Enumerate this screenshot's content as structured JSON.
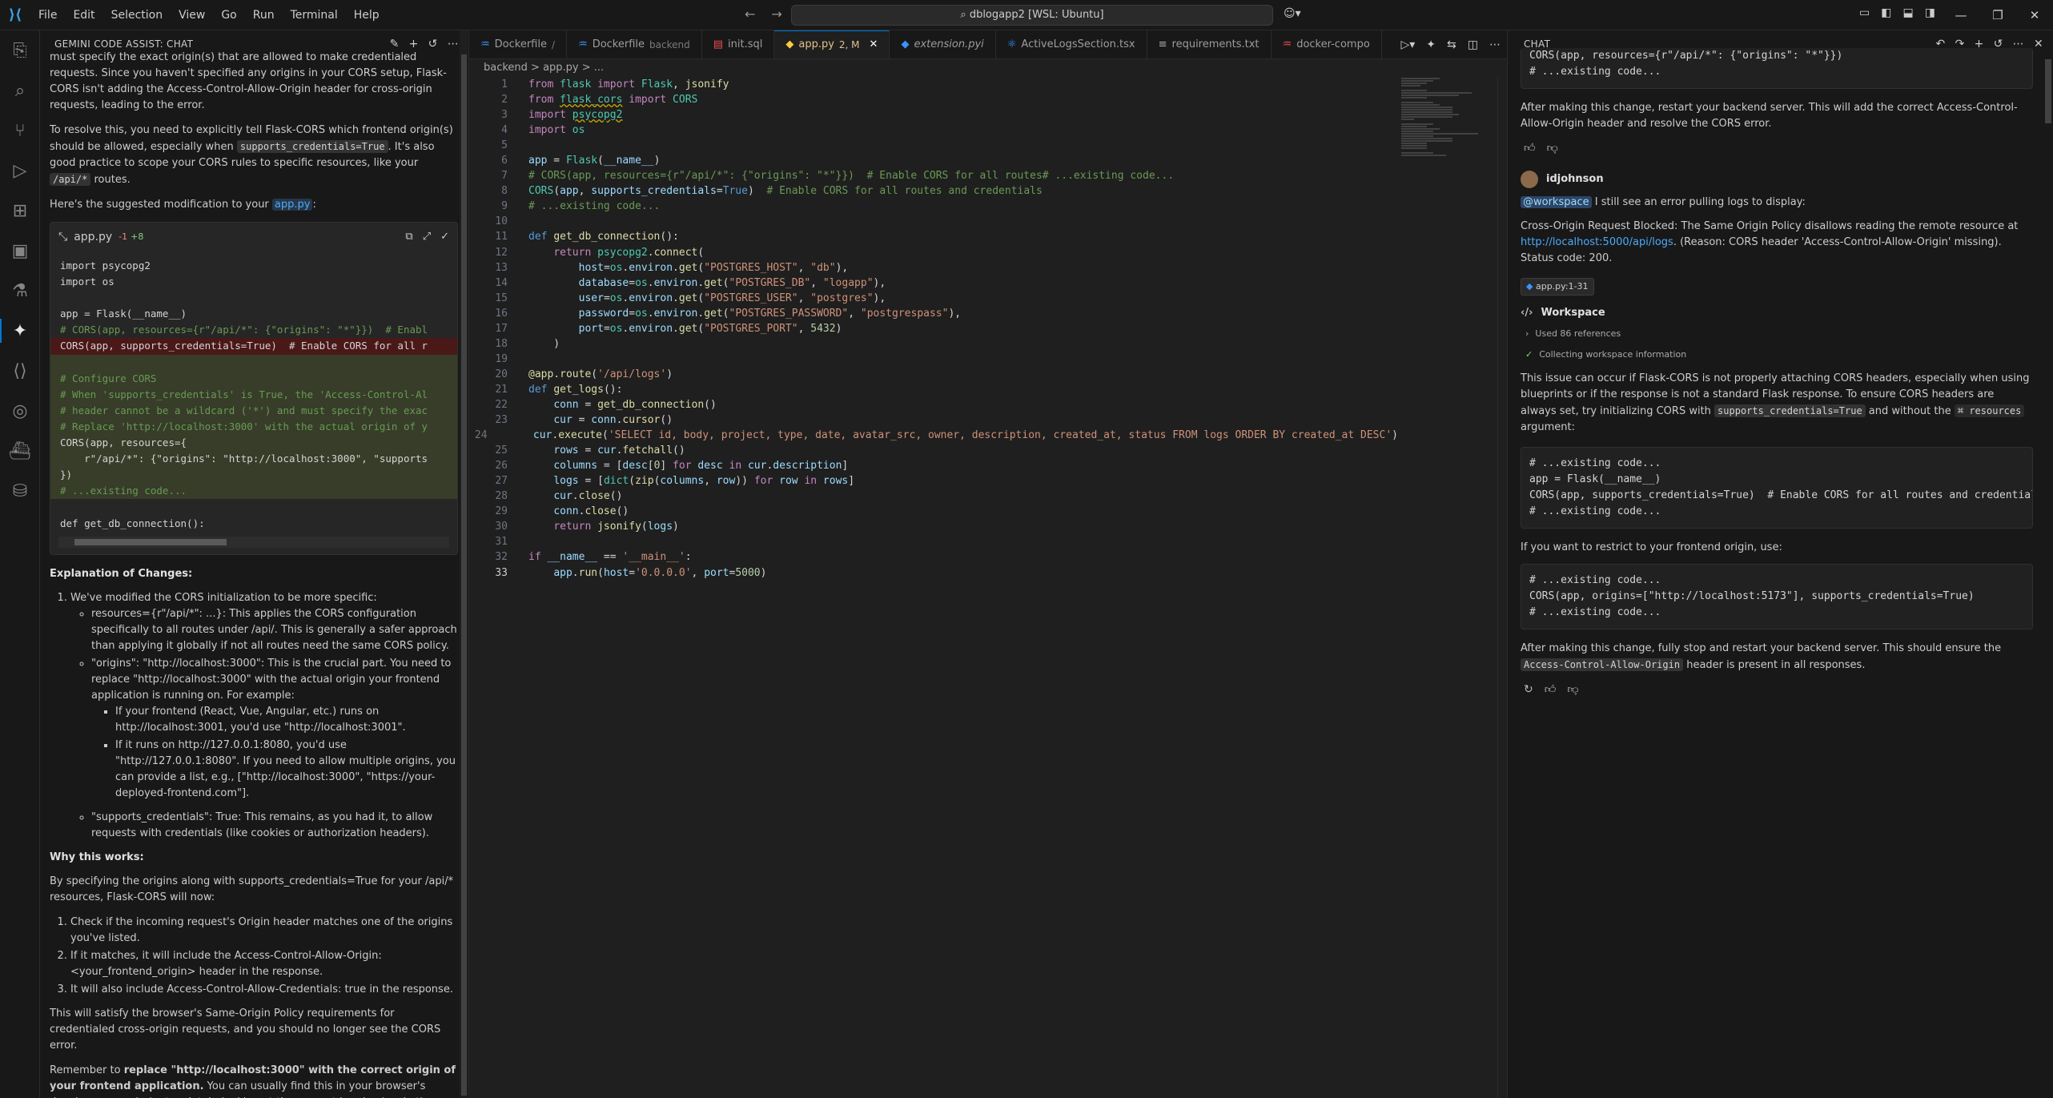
{
  "titlebar": {
    "menu": [
      "File",
      "Edit",
      "Selection",
      "View",
      "Go",
      "Run",
      "Terminal",
      "Help"
    ],
    "search": "dblogapp2 [WSL: Ubuntu]"
  },
  "left_panel": {
    "title": "GEMINI CODE ASSIST: CHAT",
    "p0": "must specify the exact origin(s) that are allowed to make credentialed requests. Since you haven't specified any origins in your CORS setup, Flask-CORS isn't adding the Access-Control-Allow-Origin header for cross-origin requests, leading to the error.",
    "p1a": "To resolve this, you need to explicitly tell Flask-CORS which frontend origin(s) should be allowed, especially when ",
    "p1code": "supports_credentials=True",
    "p1b": ". It's also good practice to scope your CORS rules to specific resources, like your ",
    "p1code2": "/api/*",
    "p1c": " routes.",
    "p2a": "Here's the suggested modification to your ",
    "p2link": "app.py",
    "p2b": ":",
    "card": {
      "file": "app.py",
      "del": "-1",
      "add": "+8",
      "lines": [
        "import psycopg2",
        "import os",
        "",
        "app = Flask(__name__)",
        "# CORS(app, resources={r\"/api/*\": {\"origins\": \"*\"}})  # Enabl",
        "CORS(app, supports_credentials=True)  # Enable CORS for all r",
        "",
        "# Configure CORS",
        "# When 'supports_credentials' is True, the 'Access-Control-Al",
        "# header cannot be a wildcard ('*') and must specify the exac",
        "# Replace 'http://localhost:3000' with the actual origin of y",
        "CORS(app, resources={",
        "    r\"/api/*\": {\"origins\": \"http://localhost:3000\", \"supports",
        "})",
        "# ...existing code...",
        "",
        "def get_db_connection():"
      ]
    },
    "h_explain": "Explanation of Changes:",
    "exp1": "We've modified the CORS initialization to be more specific:",
    "exp1a": "resources={r\"/api/*\": ...}: This applies the CORS configuration specifically to all routes under /api/. This is generally a safer approach than applying it globally if not all routes need the same CORS policy.",
    "exp1b": "\"origins\": \"http://localhost:3000\": This is the crucial part. You need to replace \"http://localhost:3000\" with the actual origin your frontend application is running on. For example:",
    "exp1b1": "If your frontend (React, Vue, Angular, etc.) runs on http://localhost:3001, you'd use \"http://localhost:3001\".",
    "exp1b2": "If it runs on http://127.0.0.1:8080, you'd use \"http://127.0.0.1:8080\". If you need to allow multiple origins, you can provide a list, e.g., [\"http://localhost:3000\", \"https://your-deployed-frontend.com\"].",
    "exp1c": "\"supports_credentials\": True: This remains, as you had it, to allow requests with credentials (like cookies or authorization headers).",
    "h_why": "Why this works:",
    "why_p": "By specifying the origins along with supports_credentials=True for your /api/* resources, Flask-CORS will now:",
    "why1": "Check if the incoming request's Origin header matches one of the origins you've listed.",
    "why2": "If it matches, it will include the Access-Control-Allow-Origin: <your_frontend_origin> header in the response.",
    "why3": "It will also include Access-Control-Allow-Credentials: true in the response.",
    "p_satisfy": "This will satisfy the browser's Same-Origin Policy requirements for credentialed cross-origin requests, and you should no longer see the CORS error.",
    "p_rem_a": "Remember to ",
    "p_rem_b": "replace \"http://localhost:3000\" with the correct origin of your frontend application.",
    "p_rem_c": " You can usually find this in your browser's developer console (network tab, looking at the request headers) or in the startup messages of your frontend development server."
  },
  "editor": {
    "tabs": [
      {
        "label": "Dockerfile",
        "sub": "/",
        "icon": "docker"
      },
      {
        "label": "Dockerfile",
        "sub": "backend",
        "icon": "docker"
      },
      {
        "label": "init.sql",
        "sub": "",
        "icon": "sql"
      },
      {
        "label": "app.py",
        "sub": "2, M",
        "icon": "py"
      },
      {
        "label": "extension.pyi",
        "sub": "",
        "icon": "ext"
      },
      {
        "label": "ActiveLogsSection.tsx",
        "sub": "",
        "icon": "tsx"
      },
      {
        "label": "requirements.txt",
        "sub": "",
        "icon": "txt"
      },
      {
        "label": "docker-compo",
        "sub": "",
        "icon": "dc"
      }
    ],
    "breadcrumb": "backend > app.py > ..."
  },
  "right_panel": {
    "title": "CHAT",
    "top_code": "CORS(app, resources={r\"/api/*\": {\"origins\": \"*\"}})\n# ...existing code...",
    "p_after": "After making this change, restart your backend server. This will add the correct Access-Control-Allow-Origin header and resolve the CORS error.",
    "user": "idjohnson",
    "mention": "@workspace",
    "user_msg": " I still see an error pulling logs to display:",
    "err_a": "Cross-Origin Request Blocked: The Same Origin Policy disallows reading the remote resource at ",
    "err_link": "http://localhost:5000/api/logs",
    "err_b": ". (Reason: CORS header 'Access-Control-Allow-Origin' missing). Status code: 200.",
    "ref": "app.py:1-31",
    "workspace": "Workspace",
    "used": "Used 86 references",
    "collecting": "Collecting workspace information",
    "issue_a": "This issue can occur if Flask-CORS is not properly attaching CORS headers, especially when using blueprints or if the response is not a standard Flask response. To ensure CORS headers are always set, try initializing CORS with ",
    "issue_code": "supports_credentials=True",
    "issue_b": " and without the ",
    "issue_c": "resources",
    "issue_d": " argument:",
    "code2": "# ...existing code...\napp = Flask(__name__)\nCORS(app, supports_credentials=True)  # Enable CORS for all routes and credentials\n# ...existing code...",
    "p_restrict": "If you want to restrict to your frontend origin, use:",
    "code3": "# ...existing code...\nCORS(app, origins=[\"http://localhost:5173\"], supports_credentials=True)\n# ...existing code...",
    "p_final_a": "After making this change, fully stop and restart your backend server. This should ensure the ",
    "p_final_code": "Access-Control-Allow-Origin",
    "p_final_b": " header is present in all responses."
  }
}
